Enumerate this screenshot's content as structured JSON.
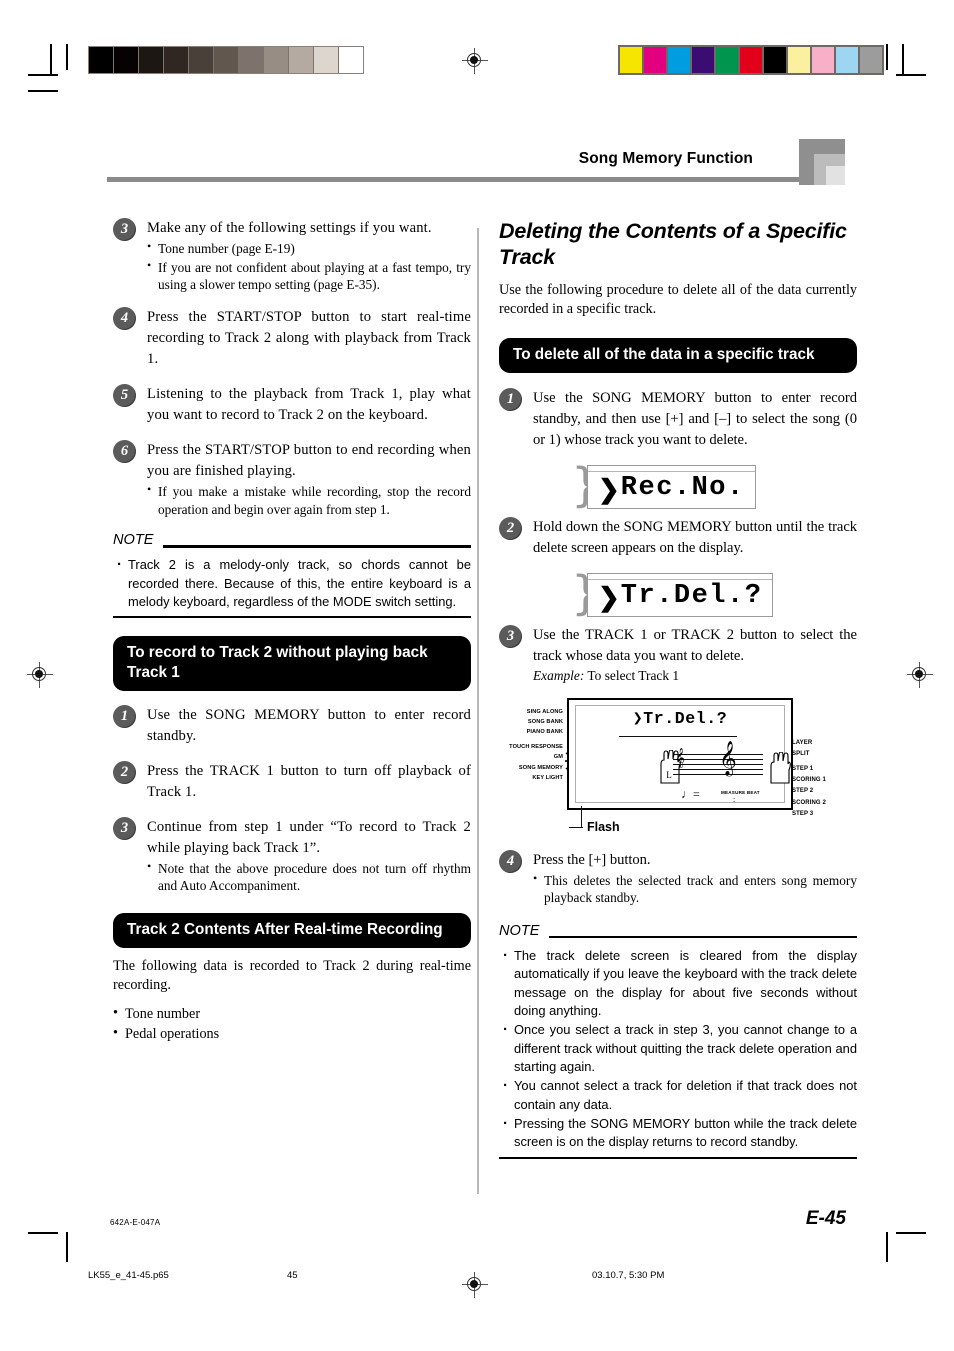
{
  "header": {
    "title": "Song Memory Function"
  },
  "left_column": {
    "steps": [
      {
        "num": "3",
        "text": "Make any of the following settings if you want.",
        "sub": [
          "Tone number (page E-19)",
          "If you are not confident about playing at a fast tempo, try using a slower tempo setting (page E-35)."
        ]
      },
      {
        "num": "4",
        "text": "Press the START/STOP button to start real-time recording to Track 2 along with playback from Track 1.",
        "sub": []
      },
      {
        "num": "5",
        "text": "Listening to the playback from Track 1, play what you want to record to Track 2 on the keyboard.",
        "sub": []
      },
      {
        "num": "6",
        "text": "Press the START/STOP button to end recording when you are finished playing.",
        "sub": [
          "If you make a mistake while recording, stop the record operation and begin over again from step 1."
        ]
      }
    ],
    "note": {
      "label": "NOTE",
      "items": [
        "Track 2 is a melody-only track, so chords cannot be recorded there. Because of this, the entire keyboard is a melody keyboard, regardless of the MODE switch setting."
      ]
    },
    "heading_1": "To record to Track 2 without playing back Track 1",
    "steps_b": [
      {
        "num": "1",
        "text": "Use the SONG MEMORY button to enter record standby.",
        "sub": []
      },
      {
        "num": "2",
        "text": "Press the TRACK 1 button to turn off playback of Track 1.",
        "sub": []
      },
      {
        "num": "3",
        "text": "Continue from step 1 under “To record to Track 2 while playing back Track 1”.",
        "sub": [
          "Note that the above procedure does not turn off rhythm and Auto Accompaniment."
        ]
      }
    ],
    "heading_2": "Track 2 Contents After Real-time Recording",
    "paragraph": "The following data is recorded to Track 2 during real-time recording.",
    "bullets": [
      "Tone number",
      "Pedal operations"
    ]
  },
  "right_column": {
    "section_title": "Deleting the Contents of a Specific Track",
    "intro": "Use the following procedure to delete all of the data currently recorded in a specific track.",
    "heading": "To delete all of the data in a specific track",
    "steps": [
      {
        "num": "1",
        "text": "Use the SONG MEMORY button to enter record standby, and then use [+] and [–] to select the song (0 or 1) whose track you want to delete."
      },
      {
        "num": "2",
        "text": "Hold down the SONG MEMORY button until the track delete screen appears on the display."
      },
      {
        "num": "3",
        "text": "Use the TRACK 1 or TRACK 2 button to select the track whose data you want to delete."
      },
      {
        "num": "4",
        "text": "Press the [+] button."
      }
    ],
    "lcd_1": {
      "cursor": "❯",
      "text": "Rec.No."
    },
    "lcd_2": {
      "cursor": "❯",
      "text": "Tr.Del.?"
    },
    "example_label": "Example:",
    "example_text": "To select Track 1",
    "step4_sub": [
      "This deletes the selected track and enters song memory playback standby."
    ],
    "note": {
      "label": "NOTE",
      "items": [
        "The track delete screen is cleared from the display automatically if you leave the keyboard with the track delete message on the display for about five seconds without doing anything.",
        "Once you select a track in step 3, you cannot change to a different track without quitting the track delete operation and starting again.",
        "You cannot select a track for deletion if that track does not contain any data.",
        "Pressing the SONG MEMORY button while the track delete screen is on the display returns to record standby."
      ]
    }
  },
  "keyboard_figure": {
    "lcd_text": "Tr.Del.?",
    "lcd_cursor": "❯",
    "left_labels": [
      "SING ALONG",
      "SONG BANK",
      "PIANO BANK"
    ],
    "left_labels_2": [
      "TOUCH RESPONSE",
      "GM",
      "SONG MEMORY",
      "KEY LIGHT"
    ],
    "right_labels": [
      "LAYER",
      "SPLIT"
    ],
    "right_labels_2": [
      "STEP 1",
      "SCORING 1",
      "STEP 2",
      "SCORING 2",
      "STEP 3"
    ],
    "measure_beat": "MEASURE BEAT",
    "hand_left": "L",
    "flash_label": "Flash"
  },
  "footer": {
    "doc_code": "642A-E-047A",
    "page_number": "E-45",
    "file_name": "LK55_e_41-45.p65",
    "sheet_number": "45",
    "timestamp": "03.10.7, 5:30 PM"
  },
  "calibration": {
    "gray_bar": [
      "#000000",
      "#060204",
      "#1c1713",
      "#302723",
      "#4a403a",
      "#62574f",
      "#7e736c",
      "#988d85",
      "#b5aaa2",
      "#ddd6cf",
      "#ffffff"
    ],
    "color_bar": [
      "#f6e500",
      "#e2007e",
      "#009ee0",
      "#3b0d73",
      "#00954e",
      "#e2001a",
      "#000000",
      "#faf0a0",
      "#f8b0c8",
      "#9ed6f2",
      "#9c9c9c"
    ]
  }
}
